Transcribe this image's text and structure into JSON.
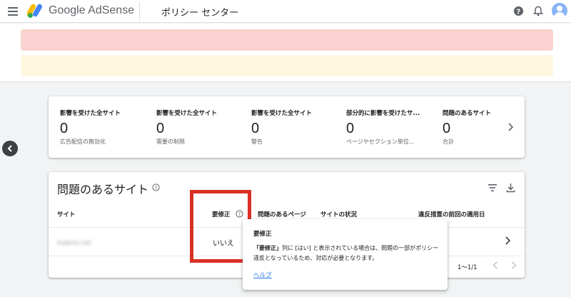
{
  "header": {
    "brand": "Google AdSense",
    "page_title": "ポリシー センター",
    "icons": [
      "menu-icon",
      "adsense-logo",
      "help-icon",
      "bell-icon",
      "avatar"
    ]
  },
  "colors": {
    "banner_error": "#fad2cf",
    "banner_warning": "#fef7e0",
    "highlight": "#d93025",
    "link": "#1a73e8"
  },
  "stats": [
    {
      "label": "影響を受けた全サイト",
      "value": "0",
      "sub": "広告配信の無効化"
    },
    {
      "label": "影響を受けた全サイト",
      "value": "0",
      "sub": "需要の制限"
    },
    {
      "label": "影響を受けた全サイト",
      "value": "0",
      "sub": "警告"
    },
    {
      "label": "部分的に影響を受けたサ...",
      "value": "0",
      "sub": "ページやセクション単位..."
    },
    {
      "label": "問題のあるサイト",
      "value": "0",
      "sub": "合計"
    }
  ],
  "table": {
    "title": "問題のあるサイト",
    "columns": [
      "サイト",
      "要修正",
      "問題のあるページ",
      "サイトの状況",
      "違反措置の前回の適用日"
    ],
    "rows": [
      {
        "site": "hidemi.net",
        "requires_fix": "いいえ"
      }
    ],
    "pagination": "1〜1/1"
  },
  "tooltip": {
    "title": "要修正",
    "body_bold": "「要修正」",
    "body_text": "列に [はい] と表示されている場合は、問題の一部がポリシー違反となっているため、対応が必要となります。",
    "link": "ヘルプ"
  }
}
